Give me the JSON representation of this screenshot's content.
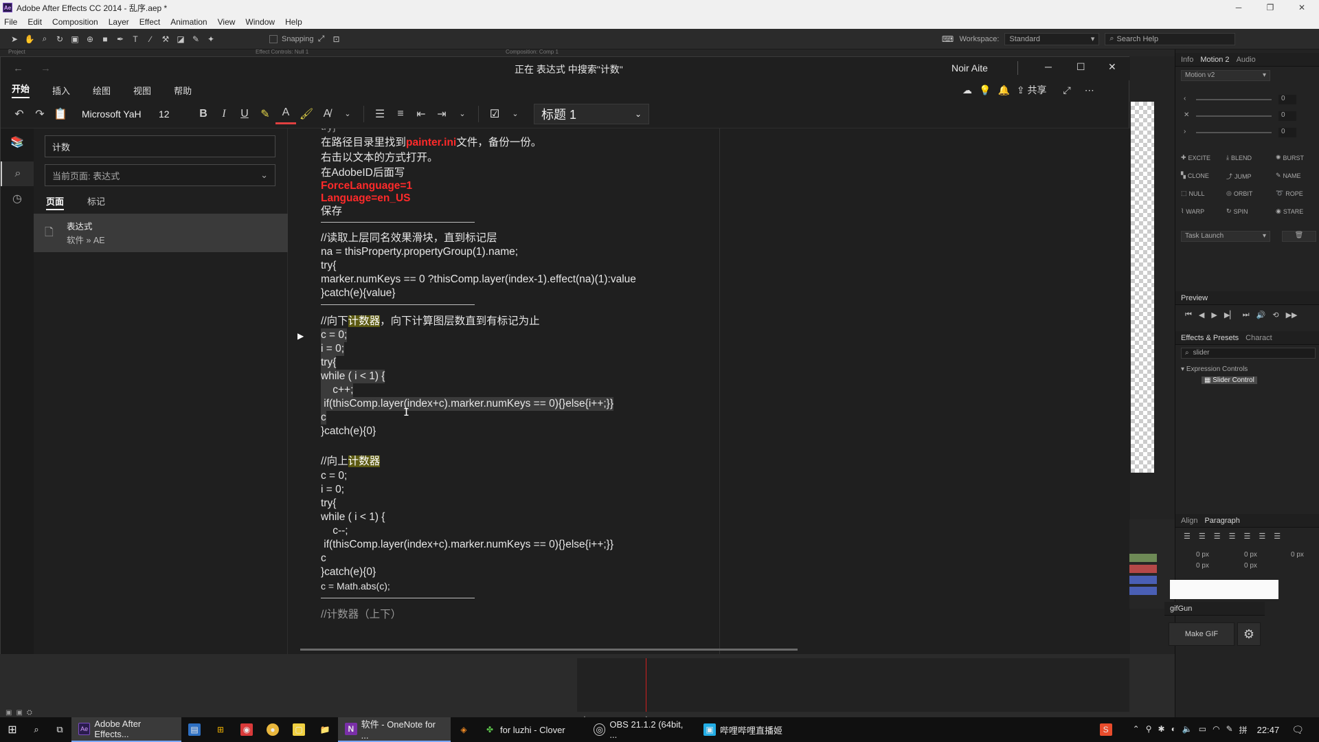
{
  "ae": {
    "title": "Adobe After Effects CC 2014 - 乱序.aep *",
    "menu": [
      "File",
      "Edit",
      "Composition",
      "Layer",
      "Effect",
      "Animation",
      "View",
      "Window",
      "Help"
    ],
    "snapping_label": "Snapping",
    "workspace_label": "Workspace:",
    "workspace_value": "Standard",
    "search_help_placeholder": "Search Help",
    "panel_tabs_top": [
      "Project",
      "Effect Controls: Null 1",
      "Composition: Comp 1"
    ],
    "right": {
      "tabs_top": [
        "Info",
        "Motion 2",
        "Audio"
      ],
      "motion_dropdown": "Motion v2",
      "slider_values": [
        "0",
        "0",
        "0"
      ],
      "motion_buttons": [
        "EXCITE",
        "BLEND",
        "BURST",
        "CLONE",
        "JUMP",
        "NAME",
        "NULL",
        "ORBIT",
        "ROPE",
        "WARP",
        "SPIN",
        "STARE"
      ],
      "task_launch": "Task Launch",
      "preview_tab": "Preview",
      "effects_tabs": [
        "Effects & Presets",
        "Charact"
      ],
      "effects_search": "slider",
      "tree_group": "Expression Controls",
      "tree_item": "Slider Control",
      "align_tabs": [
        "Align",
        "Paragraph"
      ],
      "px_values": [
        "0 px",
        "0 px",
        "0 px",
        "0 px",
        "0 px"
      ],
      "gifgun_tab": "gifGun",
      "make_gif": "Make GIF"
    }
  },
  "onenote": {
    "search_title": "正在 表达式 中搜索\"计数\"",
    "user_name": "Noir Aite",
    "tabs": [
      "开始",
      "插入",
      "绘图",
      "视图",
      "帮助"
    ],
    "font_name": "Microsoft YaH",
    "font_size": "12",
    "style_value": "标题 1",
    "share_label": "共享",
    "search_query": "计数",
    "search_scope": "当前页面: 表达式",
    "result_tabs": [
      "页面",
      "标记"
    ],
    "result_title": "表达式",
    "result_path": "软件 » AE",
    "page": {
      "top_fragment": "try}",
      "l1_pre": "在路径目录里找到",
      "l1_red": "painter.ini",
      "l1_post": "文件，备份一份。",
      "l2": "右击以文本的方式打开。",
      "l3": "在AdobeID后面写",
      "l4": "ForceLanguage=1",
      "l5": "Language=en_US",
      "l6": "保存",
      "b1": [
        "//读取上层同名效果滑块，直到标记层",
        "na = thisProperty.propertyGroup(1).name;",
        "try{",
        "marker.numKeys == 0 ?thisComp.layer(index-1).effect(na)(1):value",
        "}catch(e){value}"
      ],
      "b2_head_pre": "//向下",
      "b2_head_hl": "计数器",
      "b2_head_post": "，向下计算图层数直到有标记为止",
      "b2": [
        "c = 0;",
        "i = 0;",
        "try{",
        "while ( i < 1) {",
        "    c++;",
        " if(thisComp.layer(index+c).marker.numKeys == 0){}else{i++;}}",
        "c",
        "}catch(e){0}"
      ],
      "b3_head_pre": "//向上",
      "b3_head_hl": "计数器",
      "b3": [
        "c = 0;",
        "i = 0;",
        "try{",
        "while ( i < 1) {",
        "    c--;",
        " if(thisComp.layer(index+c).marker.numKeys == 0){}else{i++;}}",
        "c",
        "}catch(e){0}",
        "c = Math.abs(c);"
      ],
      "b4_fragment": "//计数器（上下）"
    }
  },
  "taskbar": {
    "apps": [
      "Adobe After Effects...",
      "软件 - OneNote for ...",
      "for luzhi - Clover",
      "OBS 21.1.2 (64bit, ...",
      "哔哩哔哩直播姬"
    ],
    "time": "22:47"
  }
}
